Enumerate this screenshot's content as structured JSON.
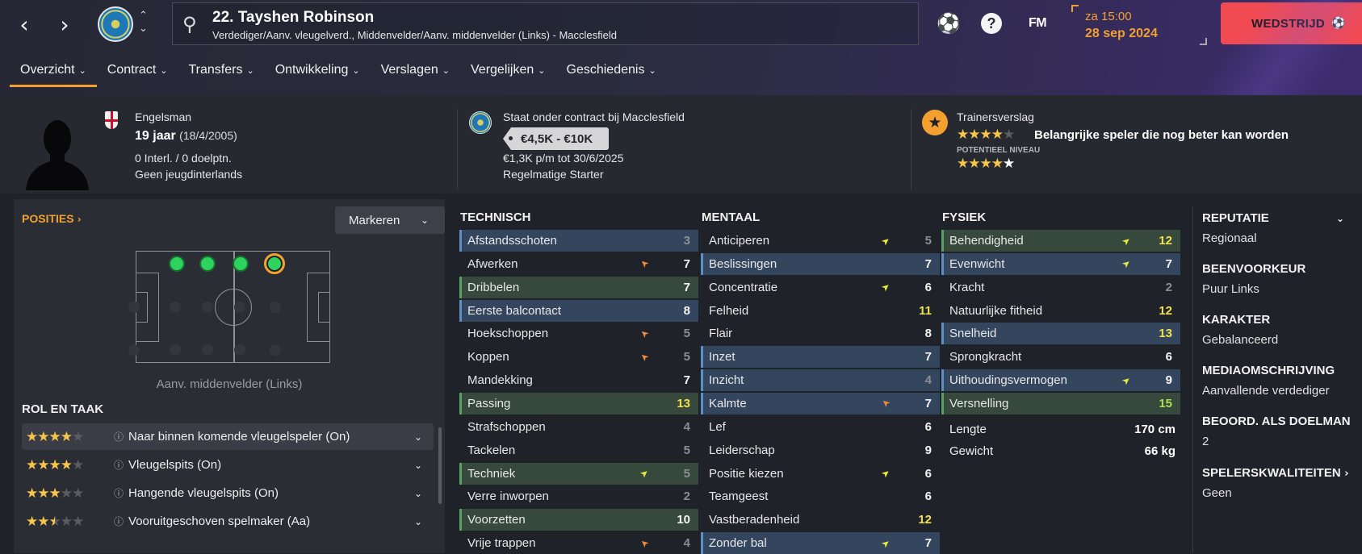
{
  "topbar": {
    "back_icon": "chevron-left-icon",
    "forward_icon": "chevron-right-icon",
    "player_name": "22. Tayshen Robinson",
    "player_sub": "Verdediger/Aanv. vleugelverd., Middenvelder/Aanv. middenvelder (Links) - Macclesfield",
    "fm_label": "FM",
    "time": "za 15:00",
    "date": "28 sep 2024",
    "match_button": "WEDSTRIJD"
  },
  "tabs": [
    {
      "label": "Overzicht"
    },
    {
      "label": "Contract"
    },
    {
      "label": "Transfers"
    },
    {
      "label": "Ontwikkeling"
    },
    {
      "label": "Verslagen"
    },
    {
      "label": "Vergelijken"
    },
    {
      "label": "Geschiedenis"
    }
  ],
  "profile": {
    "nationality": "Engelsman",
    "age": "19 jaar",
    "dob": "(18/4/2005)",
    "caps": "0 Interl. / 0 doelptn.",
    "youth_caps": "Geen jeugdinterlands"
  },
  "contract": {
    "club_line": "Staat onder contract bij Macclesfield",
    "value": "€4,5K - €10K",
    "wage": "€1,3K p/m tot 30/6/2025",
    "status": "Regelmatige Starter"
  },
  "coach_report": {
    "title": "Trainersverslag",
    "current_stars": 4,
    "summary": "Belangrijke speler die nog beter kan worden",
    "potential_label": "POTENTIEEL NIVEAU",
    "potential_stars": 4.5
  },
  "positions": {
    "header": "POSITIES",
    "mark_button": "Markeren",
    "label": "Aanv. middenvelder (Links)"
  },
  "roles": {
    "header": "ROL EN TAAK",
    "items": [
      {
        "stars": 4,
        "label": "Naar binnen komende vleugelspeler (On)"
      },
      {
        "stars": 4,
        "label": "Vleugelspits (On)"
      },
      {
        "stars": 3,
        "label": "Hangende vleugelspits (On)"
      },
      {
        "stars": 2.5,
        "label": "Vooruitgeschoven spelmaker (Aa)"
      }
    ]
  },
  "technisch": {
    "header": "TECHNISCH",
    "items": [
      {
        "label": "Afstandsschoten",
        "value": "3",
        "hl": "blue",
        "color": "grey",
        "arrow": ""
      },
      {
        "label": "Afwerken",
        "value": "7",
        "hl": "",
        "color": "white",
        "arrow": "down"
      },
      {
        "label": "Dribbelen",
        "value": "7",
        "hl": "green",
        "color": "white",
        "arrow": ""
      },
      {
        "label": "Eerste balcontact",
        "value": "8",
        "hl": "blue",
        "color": "white",
        "arrow": ""
      },
      {
        "label": "Hoekschoppen",
        "value": "5",
        "hl": "",
        "color": "grey",
        "arrow": "down"
      },
      {
        "label": "Koppen",
        "value": "5",
        "hl": "",
        "color": "grey",
        "arrow": "down"
      },
      {
        "label": "Mandekking",
        "value": "7",
        "hl": "",
        "color": "white",
        "arrow": ""
      },
      {
        "label": "Passing",
        "value": "13",
        "hl": "green",
        "color": "yellow",
        "arrow": ""
      },
      {
        "label": "Strafschoppen",
        "value": "4",
        "hl": "",
        "color": "grey",
        "arrow": ""
      },
      {
        "label": "Tackelen",
        "value": "5",
        "hl": "",
        "color": "grey",
        "arrow": ""
      },
      {
        "label": "Techniek",
        "value": "5",
        "hl": "green",
        "color": "grey",
        "arrow": "up"
      },
      {
        "label": "Verre inworpen",
        "value": "2",
        "hl": "",
        "color": "grey",
        "arrow": ""
      },
      {
        "label": "Voorzetten",
        "value": "10",
        "hl": "green",
        "color": "white",
        "arrow": ""
      },
      {
        "label": "Vrije trappen",
        "value": "4",
        "hl": "",
        "color": "grey",
        "arrow": "down"
      }
    ]
  },
  "mentaal": {
    "header": "MENTAAL",
    "items": [
      {
        "label": "Anticiperen",
        "value": "5",
        "hl": "",
        "color": "grey",
        "arrow": "up"
      },
      {
        "label": "Beslissingen",
        "value": "7",
        "hl": "blue",
        "color": "white",
        "arrow": ""
      },
      {
        "label": "Concentratie",
        "value": "6",
        "hl": "",
        "color": "white",
        "arrow": "up"
      },
      {
        "label": "Felheid",
        "value": "11",
        "hl": "",
        "color": "yellow",
        "arrow": ""
      },
      {
        "label": "Flair",
        "value": "8",
        "hl": "",
        "color": "white",
        "arrow": ""
      },
      {
        "label": "Inzet",
        "value": "7",
        "hl": "blue",
        "color": "white",
        "arrow": ""
      },
      {
        "label": "Inzicht",
        "value": "4",
        "hl": "blue",
        "color": "grey",
        "arrow": ""
      },
      {
        "label": "Kalmte",
        "value": "7",
        "hl": "blue",
        "color": "white",
        "arrow": "down"
      },
      {
        "label": "Lef",
        "value": "6",
        "hl": "",
        "color": "white",
        "arrow": ""
      },
      {
        "label": "Leiderschap",
        "value": "9",
        "hl": "",
        "color": "white",
        "arrow": ""
      },
      {
        "label": "Positie kiezen",
        "value": "6",
        "hl": "",
        "color": "white",
        "arrow": "up"
      },
      {
        "label": "Teamgeest",
        "value": "6",
        "hl": "",
        "color": "white",
        "arrow": ""
      },
      {
        "label": "Vastberadenheid",
        "value": "12",
        "hl": "",
        "color": "yellow",
        "arrow": ""
      },
      {
        "label": "Zonder bal",
        "value": "7",
        "hl": "blue",
        "color": "white",
        "arrow": "up"
      }
    ]
  },
  "fysiek": {
    "header": "FYSIEK",
    "items": [
      {
        "label": "Behendigheid",
        "value": "12",
        "hl": "green",
        "color": "yellow",
        "arrow": "up"
      },
      {
        "label": "Evenwicht",
        "value": "7",
        "hl": "blue",
        "color": "white",
        "arrow": "up"
      },
      {
        "label": "Kracht",
        "value": "2",
        "hl": "",
        "color": "grey",
        "arrow": ""
      },
      {
        "label": "Natuurlijke fitheid",
        "value": "12",
        "hl": "",
        "color": "yellow",
        "arrow": ""
      },
      {
        "label": "Snelheid",
        "value": "13",
        "hl": "blue",
        "color": "yellow",
        "arrow": ""
      },
      {
        "label": "Sprongkracht",
        "value": "6",
        "hl": "",
        "color": "white",
        "arrow": ""
      },
      {
        "label": "Uithoudingsvermogen",
        "value": "9",
        "hl": "blue",
        "color": "white",
        "arrow": "up"
      },
      {
        "label": "Versnelling",
        "value": "15",
        "hl": "green",
        "color": "green",
        "arrow": ""
      }
    ],
    "height_label": "Lengte",
    "height": "170 cm",
    "weight_label": "Gewicht",
    "weight": "66 kg"
  },
  "sidebar": [
    {
      "head": "REPUTATIE",
      "value": "Regionaal"
    },
    {
      "head": "BEENVOORKEUR",
      "value": "Puur Links"
    },
    {
      "head": "KARAKTER",
      "value": "Gebalanceerd"
    },
    {
      "head": "MEDIAOMSCHRIJVING",
      "value": "Aanvallende verdediger"
    },
    {
      "head": "BEOORD. ALS DOELMAN",
      "value": "2"
    },
    {
      "head": "SPELERSKWALITEITEN",
      "value": "Geen"
    }
  ],
  "colors": {
    "accent": "#f3a030",
    "match_button": "#f24a52",
    "attr_blue": "#34465e",
    "attr_green": "#37493c"
  }
}
